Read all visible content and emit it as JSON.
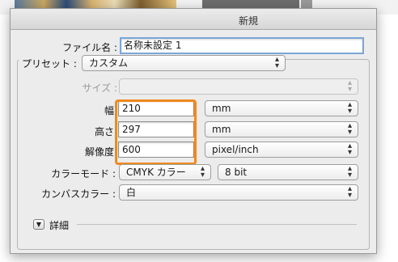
{
  "window": {
    "title": "新規"
  },
  "filename": {
    "label": "ファイル名 :",
    "value": "名称未設定 1"
  },
  "preset": {
    "label": "プリセット :",
    "value": "カスタム"
  },
  "size": {
    "label": "サイズ :",
    "value": ""
  },
  "width": {
    "label": "幅",
    "value": "210",
    "unit": "mm"
  },
  "height": {
    "label": "高さ",
    "value": "297",
    "unit": "mm"
  },
  "resolution": {
    "label": "解像度",
    "value": "600",
    "unit": "pixel/inch"
  },
  "color_mode": {
    "label": "カラーモード :",
    "value": "CMYK カラー",
    "depth": "8 bit"
  },
  "canvas_color": {
    "label": "カンバスカラー :",
    "value": "白"
  },
  "details": {
    "label": "詳細",
    "icon": "disclosure-triangle-icon"
  },
  "colors": {
    "highlight": "#f08a1e",
    "focus": "#7aa7d8"
  }
}
